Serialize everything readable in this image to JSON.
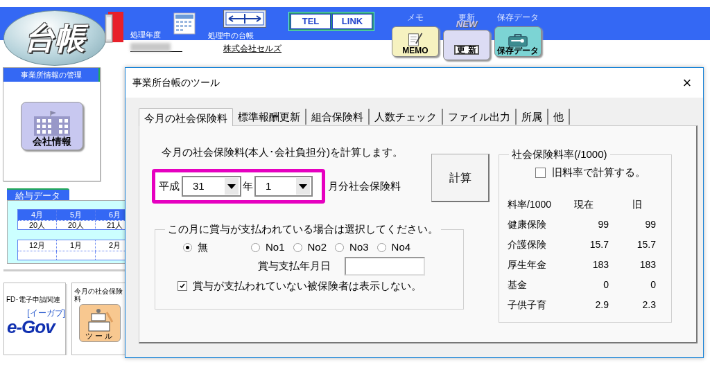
{
  "header": {
    "logo": "台帳",
    "fiscal_year_label": "処理年度",
    "current_ledger_label": "処理中の台帳",
    "company": "株式会社セルズ",
    "link_buttons": [
      "TEL",
      "LINK"
    ],
    "toolbar": [
      {
        "label": "メモ",
        "kind": "memo",
        "icon_text": "MEMO"
      },
      {
        "label": "更新",
        "kind": "update",
        "icon_text": "更 新",
        "badge": "NEW"
      },
      {
        "label": "保存データ",
        "kind": "saved",
        "icon_text": "保存データ"
      }
    ]
  },
  "sidebar": {
    "office_panel": {
      "title": "事業所情報の管理",
      "button": "会社情報"
    },
    "salary_panel": {
      "title": "給与データ",
      "rows": [
        {
          "months": [
            "4月",
            "5月",
            "6月"
          ],
          "counts": [
            "20人",
            "20人",
            "21人"
          ]
        },
        {
          "months": [
            "12月",
            "1月",
            "2月"
          ]
        }
      ]
    },
    "cards": [
      {
        "kind": "egov",
        "title": "FD･電子申請関連",
        "logo": "e-Gov",
        "logo_sub": "[イーガブ]"
      },
      {
        "kind": "tool",
        "title": "今月の社会保険料",
        "icon_text": "ツール"
      }
    ]
  },
  "dialog": {
    "title": "事業所台帳のツール",
    "close": "×",
    "tabs": [
      {
        "label": "今月の社会保険料",
        "selected": true
      },
      {
        "label": "標準報酬更新",
        "selected": false
      },
      {
        "label": "組合保険料",
        "selected": false
      },
      {
        "label": "人数チェック",
        "selected": false
      },
      {
        "label": "ファイル出力",
        "selected": false
      },
      {
        "label": "所属",
        "selected": false
      },
      {
        "label": "他",
        "selected": false
      }
    ],
    "description": "今月の社会保険料(本人･会社負担分)を計算します。",
    "era": "平成",
    "year": "31",
    "year_suffix": "年",
    "month": "1",
    "month_suffix": "月分社会保険料",
    "calculate_button": "計算",
    "bonus_group": {
      "title": "この月に賞与が支払われている場合は選択してください。",
      "options": [
        {
          "label": "無",
          "selected": true
        },
        {
          "label": "No1",
          "selected": false
        },
        {
          "label": "No2",
          "selected": false
        },
        {
          "label": "No3",
          "selected": false
        },
        {
          "label": "No4",
          "selected": false
        }
      ],
      "date_label": "賞与支払年月日",
      "hide_checkbox": {
        "label": "賞与が支払われていない被保険者は表示しない。",
        "checked": true
      }
    },
    "rates_group": {
      "title": "社会保険料率(/1000)",
      "old_rate_checkbox": {
        "label": "旧料率で計算する。",
        "checked": false
      },
      "columns": [
        "料率/1000",
        "現在",
        "旧"
      ],
      "rows": [
        {
          "name": "健康保険",
          "current": "99",
          "old": "99"
        },
        {
          "name": "介護保険",
          "current": "15.7",
          "old": "15.7"
        },
        {
          "name": "厚生年金",
          "current": "183",
          "old": "183"
        },
        {
          "name": "基金",
          "current": "0",
          "old": "0"
        },
        {
          "name": "子供子育",
          "current": "2.9",
          "old": "2.3"
        }
      ]
    }
  }
}
